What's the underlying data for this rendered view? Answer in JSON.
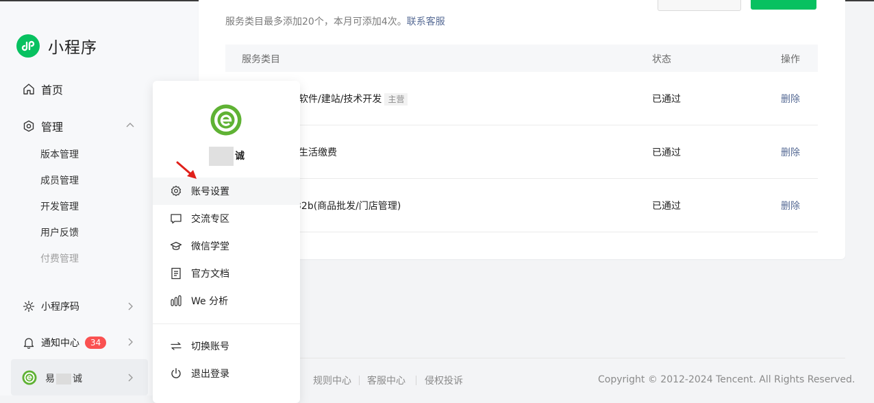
{
  "brand": {
    "title": "小程序",
    "accent": "#07c160"
  },
  "nav": {
    "home": "首页",
    "manage": "管理",
    "manage_children": [
      "版本管理",
      "成员管理",
      "开发管理",
      "用户反馈",
      "付费管理"
    ],
    "qrcode": "小程序码",
    "notifications": "通知中心",
    "notification_count": "34",
    "account_name_prefix": "易",
    "account_name_suffix": "诚"
  },
  "services": {
    "notice_text": "服务类目最多添加20个，本月可添加4次。",
    "notice_link": "联系客服",
    "columns": [
      "服务类目",
      "状态",
      "操作"
    ],
    "rows": [
      {
        "category": "软件/建站/技术开发",
        "tag": "主营",
        "status": "已通过",
        "action": "删除"
      },
      {
        "category": "生活缴费",
        "tag": "",
        "status": "已通过",
        "action": "删除"
      },
      {
        "category": "32b(商品批发/门店管理)",
        "tag": "",
        "status": "已通过",
        "action": "删除"
      }
    ]
  },
  "popover": {
    "name_suffix": "诚",
    "items": [
      "账号设置",
      "交流专区",
      "微信学堂",
      "官方文档",
      "We 分析"
    ],
    "bottom_items": [
      "切换账号",
      "退出登录"
    ]
  },
  "footer": {
    "links": [
      "规则中心",
      "客服中心",
      "侵权投诉"
    ],
    "copyright": "Copyright © 2012-2024 Tencent. All Rights Reserved."
  },
  "colors": {
    "badge": "#fa5151",
    "link": "#576b95",
    "arrow": "#e0201a"
  }
}
